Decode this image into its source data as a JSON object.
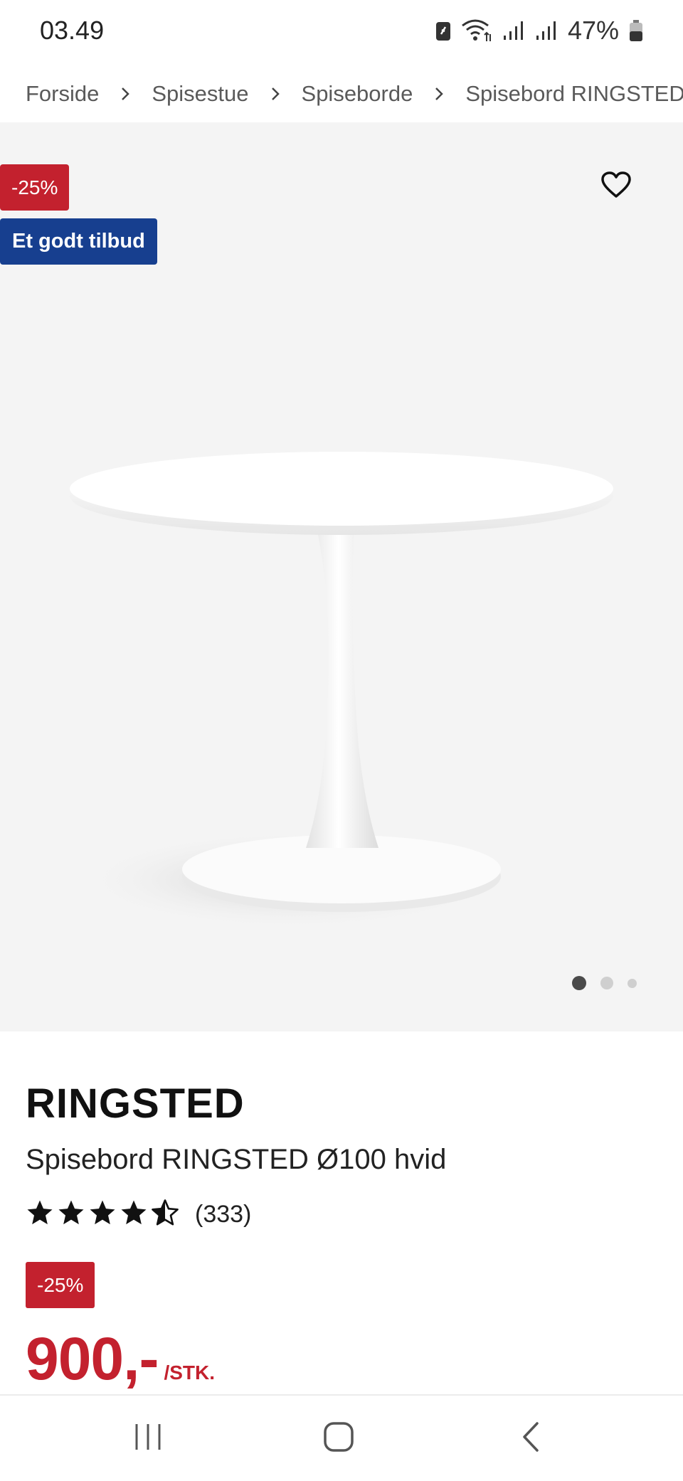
{
  "status_bar": {
    "time": "03.49",
    "battery_percent": "47%",
    "icons": [
      "battery-saver-icon",
      "wifi-icon",
      "signal-icon",
      "signal-icon",
      "battery-icon"
    ]
  },
  "breadcrumb": {
    "items": [
      "Forside",
      "Spisestue",
      "Spiseborde",
      "Spisebord RINGSTED Ø"
    ],
    "separator_icon": "chevron-right-icon"
  },
  "gallery": {
    "discount_badge": "-25%",
    "offer_badge": "Et godt tilbud",
    "wishlist_icon": "heart-outline-icon",
    "image_count": 3,
    "active_image_index": 0
  },
  "product": {
    "brand": "RINGSTED",
    "name": "Spisebord RINGSTED Ø100 hvid",
    "rating": 4.5,
    "rating_max": 5,
    "review_count": "(333)",
    "price_badge": "-25%",
    "price": "900,-",
    "price_unit": "/STK."
  },
  "nav_bar": {
    "buttons": [
      "recents-icon",
      "home-icon",
      "back-icon"
    ]
  },
  "colors": {
    "sale_red": "#c3212e",
    "offer_blue": "#173f8f",
    "gallery_bg": "#f4f4f4"
  }
}
